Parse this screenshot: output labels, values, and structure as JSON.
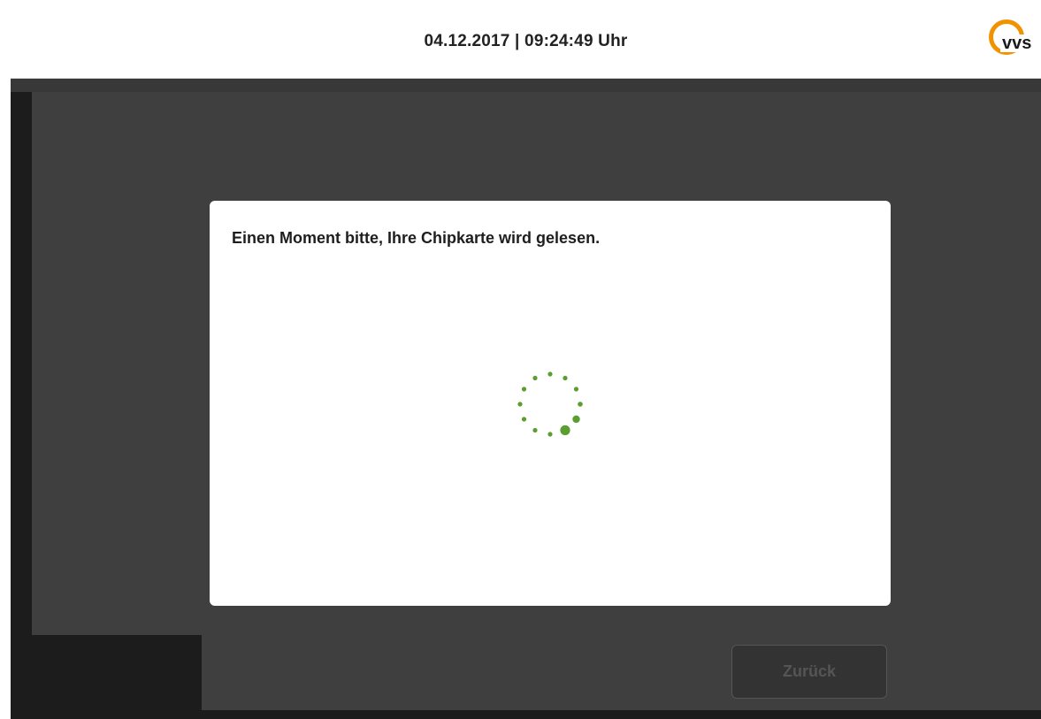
{
  "header": {
    "datetime": "04.12.2017 | 09:24:49 Uhr",
    "logo_text": "vvs"
  },
  "dialog": {
    "message": "Einen Moment bitte, Ihre Chipkarte wird gelesen.",
    "spinner_icon": "loading-spinner-icon"
  },
  "footer": {
    "back_label": "Zurück"
  },
  "colors": {
    "accent_green": "#5a9e2f",
    "logo_orange": "#f39200",
    "panel_dark": "#3f3f3f",
    "frame_dark": "#1c1c1c"
  }
}
